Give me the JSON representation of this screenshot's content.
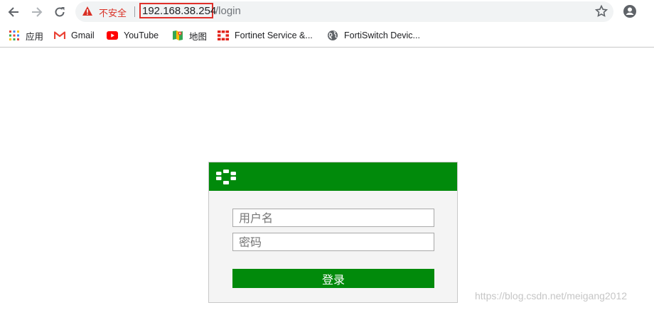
{
  "browser": {
    "address_bar": {
      "security_label": "不安全",
      "host": "192.168.38.254",
      "path": "/login"
    },
    "bookmarks": [
      {
        "label": "应用",
        "icon": "apps-grid-icon"
      },
      {
        "label": "Gmail",
        "icon": "gmail-icon"
      },
      {
        "label": "YouTube",
        "icon": "youtube-icon"
      },
      {
        "label": "地图",
        "icon": "maps-icon"
      },
      {
        "label": "Fortinet Service &...",
        "icon": "fortinet-icon"
      },
      {
        "label": "FortiSwitch Devic...",
        "icon": "globe-icon"
      }
    ]
  },
  "login": {
    "username_placeholder": "用户名",
    "password_placeholder": "密码",
    "submit_label": "登录"
  },
  "watermark": "https://blog.csdn.net/meigang2012",
  "colors": {
    "brand_green": "#018a0b",
    "warning_red": "#d93025"
  }
}
